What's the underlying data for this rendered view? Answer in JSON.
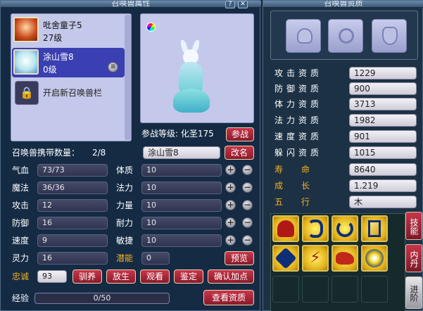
{
  "left": {
    "title": "召唤兽属性",
    "pets": [
      {
        "name": "吡舍童子5",
        "level": "27级"
      },
      {
        "name": "涂山雪8",
        "level": "0级"
      }
    ],
    "unlock_label": "开启新召唤兽栏",
    "battle_level": "参战等级: 化圣175",
    "battle_button": "参战",
    "carry_label": "召唤兽携带数量：",
    "carry_value": "2/8",
    "name_value": "涂山雪8",
    "rename_button": "改名",
    "stats_left": [
      {
        "label": "气血",
        "value": "73/73"
      },
      {
        "label": "魔法",
        "value": "36/36"
      },
      {
        "label": "攻击",
        "value": "12"
      },
      {
        "label": "防御",
        "value": "16"
      },
      {
        "label": "速度",
        "value": "9"
      },
      {
        "label": "灵力",
        "value": "16"
      }
    ],
    "stats_right": [
      {
        "label": "体质",
        "value": "10"
      },
      {
        "label": "法力",
        "value": "10"
      },
      {
        "label": "力量",
        "value": "10"
      },
      {
        "label": "耐力",
        "value": "10"
      },
      {
        "label": "敏捷",
        "value": "10"
      }
    ],
    "potential_label": "潜能",
    "potential_value": "0",
    "preview_button": "预览",
    "loyalty_label": "忠诚",
    "loyalty_value": "93",
    "actions": [
      "驯养",
      "放生",
      "观看",
      "鉴定",
      "确认加点"
    ],
    "exp_label": "经验",
    "exp_value": "0/50",
    "exp_fraction": 0.0,
    "view_quality_button": "查看资质"
  },
  "right": {
    "title": "召唤兽资质",
    "qualities": [
      {
        "label": "攻击资质",
        "value": "1229"
      },
      {
        "label": "防御资质",
        "value": "900"
      },
      {
        "label": "体力资质",
        "value": "3713"
      },
      {
        "label": "法力资质",
        "value": "1982"
      },
      {
        "label": "速度资质",
        "value": "901"
      },
      {
        "label": "躲闪资质",
        "value": "1015"
      }
    ],
    "extra": [
      {
        "label": "寿　命",
        "value": "8640"
      },
      {
        "label": "成　长",
        "value": "1.219"
      },
      {
        "label": "五　行",
        "value": "木"
      }
    ],
    "skills_button": "技能",
    "inner_dan_button": "内丹",
    "advance_button": "进阶"
  }
}
